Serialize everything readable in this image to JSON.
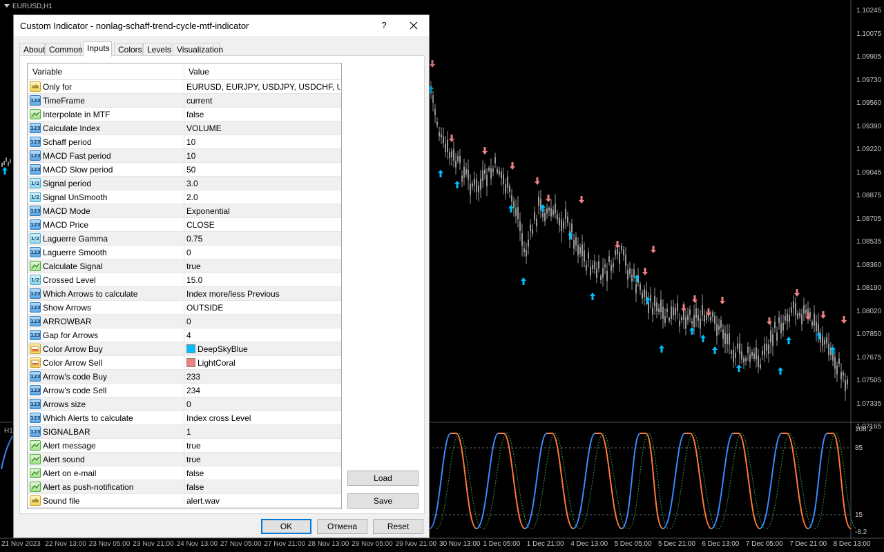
{
  "chart": {
    "symbol_label": "EURUSD,H1",
    "subwindow_label": "H1",
    "price_ticks": [
      "1.10245",
      "1.10075",
      "1.09905",
      "1.09730",
      "1.09560",
      "1.09390",
      "1.09220",
      "1.09045",
      "1.08875",
      "1.08705",
      "1.08535",
      "1.08360",
      "1.08190",
      "1.08020",
      "1.07850",
      "1.07675",
      "1.07505",
      "1.07335",
      "1.07165"
    ],
    "indicator_ticks": [
      "108.2",
      "85",
      "15",
      "-8.2"
    ],
    "time_ticks": [
      "21 Nov 2023",
      "22 Nov 13:00",
      "23 Nov 05:00",
      "23 Nov 21:00",
      "24 Nov 13:00",
      "27 Nov 05:00",
      "27 Nov 21:00",
      "28 Nov 13:00",
      "29 Nov 05:00",
      "29 Nov 21:00",
      "30 Nov 13:00",
      "1 Dec 05:00",
      "1 Dec 21:00",
      "4 Dec 13:00",
      "5 Dec 05:00",
      "5 Dec 21:00",
      "6 Dec 13:00",
      "7 Dec 05:00",
      "7 Dec 21:00",
      "8 Dec 13:00"
    ],
    "colors": {
      "background": "#000000",
      "up_arrow": "#00BFFF",
      "down_arrow": "#F08080",
      "candles": "#9a9a9a",
      "line_up": "#3a8bff",
      "line_down": "#ff7a3c"
    }
  },
  "dialog": {
    "title": "Custom Indicator - nonlag-schaff-trend-cycle-mtf-indicator",
    "help": "?",
    "tabs": [
      "About",
      "Common",
      "Inputs",
      "Colors",
      "Levels",
      "Visualization"
    ],
    "active_tab": "Inputs",
    "grid": {
      "col_variable": "Variable",
      "col_value": "Value",
      "rows": [
        {
          "type": "str",
          "name": "Only for",
          "value": "EURUSD, EURJPY, USDJPY, USDCHF, U..."
        },
        {
          "type": "int",
          "name": "TimeFrame",
          "value": "current"
        },
        {
          "type": "bool",
          "name": "Interpolate in MTF",
          "value": "false"
        },
        {
          "type": "int",
          "name": "Calculate Index",
          "value": "VOLUME"
        },
        {
          "type": "int",
          "name": "Schaff period",
          "value": "10"
        },
        {
          "type": "int",
          "name": "MACD Fast period",
          "value": "10"
        },
        {
          "type": "int",
          "name": "MACD Slow period",
          "value": "50"
        },
        {
          "type": "dbl",
          "name": "Signal period",
          "value": "3.0"
        },
        {
          "type": "dbl",
          "name": "Signal UnSmooth",
          "value": "2.0"
        },
        {
          "type": "int",
          "name": "MACD Mode",
          "value": "Exponential"
        },
        {
          "type": "int",
          "name": "MACD Price",
          "value": "CLOSE"
        },
        {
          "type": "dbl",
          "name": "Laguerre Gamma",
          "value": "0.75"
        },
        {
          "type": "int",
          "name": "Laguerre Smooth",
          "value": "0"
        },
        {
          "type": "bool",
          "name": "Calculate Signal",
          "value": "true"
        },
        {
          "type": "dbl",
          "name": "Crossed Level",
          "value": "15.0"
        },
        {
          "type": "int",
          "name": "Which Arrows to calculate",
          "value": "Index more/less Previous"
        },
        {
          "type": "int",
          "name": "Show Arrows",
          "value": "OUTSIDE"
        },
        {
          "type": "int",
          "name": "ARROWBAR",
          "value": "0"
        },
        {
          "type": "int",
          "name": "Gap for Arrows",
          "value": "4"
        },
        {
          "type": "col",
          "name": "Color Arrow Buy",
          "value": "DeepSkyBlue",
          "swatch": "#00BFFF"
        },
        {
          "type": "col",
          "name": "Color Arrow Sell",
          "value": "LightCoral",
          "swatch": "#F08080"
        },
        {
          "type": "int",
          "name": "Arrow's code Buy",
          "value": "233"
        },
        {
          "type": "int",
          "name": "Arrow's code Sell",
          "value": "234"
        },
        {
          "type": "int",
          "name": "Arrows size",
          "value": "0"
        },
        {
          "type": "int",
          "name": "Which Alerts to calculate",
          "value": "Index cross Level"
        },
        {
          "type": "int",
          "name": "SIGNALBAR",
          "value": "1"
        },
        {
          "type": "bool",
          "name": "Alert message",
          "value": "true"
        },
        {
          "type": "bool",
          "name": "Alert sound",
          "value": "true"
        },
        {
          "type": "bool",
          "name": "Alert on e-mail",
          "value": "false"
        },
        {
          "type": "bool",
          "name": "Alert as push-notification",
          "value": "false"
        },
        {
          "type": "str",
          "name": "Sound file",
          "value": "alert.wav"
        }
      ]
    },
    "buttons": {
      "load": "Load",
      "save": "Save",
      "ok": "OK",
      "cancel": "Отмена",
      "reset": "Reset"
    }
  }
}
